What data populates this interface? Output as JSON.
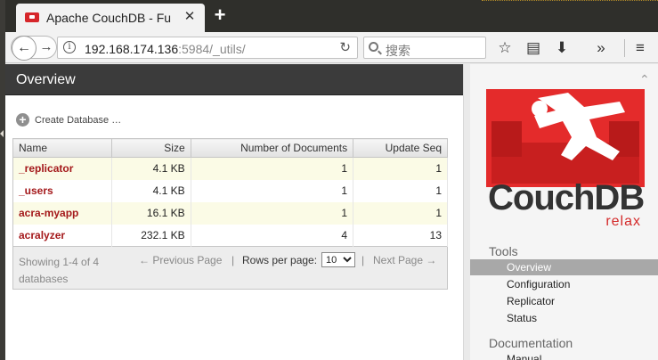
{
  "browser": {
    "tab_title": "Apache CouchDB - Futon",
    "url_host": "192.168.174.136",
    "url_rest": ":5984/_utils/",
    "search_placeholder": "搜索"
  },
  "page": {
    "header": "Overview",
    "create_database": "Create Database …",
    "columns": [
      "Name",
      "Size",
      "Number of Documents",
      "Update Seq"
    ],
    "rows": [
      {
        "name": "_replicator",
        "size": "4.1 KB",
        "docs": "1",
        "seq": "1"
      },
      {
        "name": "_users",
        "size": "4.1 KB",
        "docs": "1",
        "seq": "1"
      },
      {
        "name": "acra-myapp",
        "size": "16.1 KB",
        "docs": "1",
        "seq": "1"
      },
      {
        "name": "acralyzer",
        "size": "232.1 KB",
        "docs": "4",
        "seq": "13"
      }
    ],
    "pager": {
      "showing": "Showing 1-4 of 4 databases",
      "previous": "← Previous Page",
      "rows_per_page_label": "Rows per page:",
      "rows_per_page_value": "10",
      "next": "Next Page →"
    }
  },
  "sidebar": {
    "logo_text": "CouchDB",
    "logo_tagline": "relax",
    "tools_title": "Tools",
    "tools": [
      "Overview",
      "Configuration",
      "Replicator",
      "Status"
    ],
    "documentation_title": "Documentation",
    "documentation_items": [
      "Manual"
    ]
  },
  "colors": {
    "accent_red": "#e42b2b",
    "db_name_red": "#a4191b",
    "header_dark": "#3b3b3b"
  }
}
